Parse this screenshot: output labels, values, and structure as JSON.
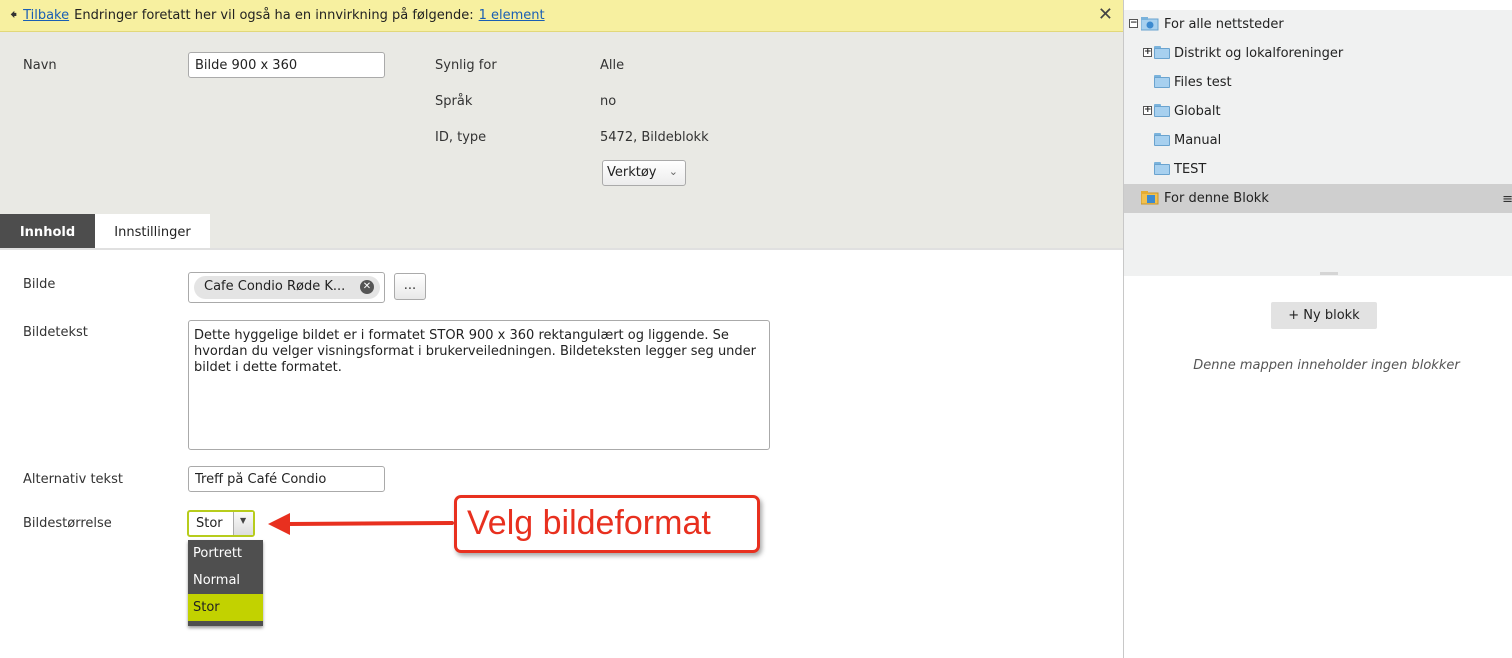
{
  "notice": {
    "back_label": "Tilbake",
    "message": "Endringer foretatt her vil også ha en innvirkning på følgende:",
    "link": "1 element",
    "close": "✕"
  },
  "header": {
    "name_label": "Navn",
    "name_value": "Bilde 900 x 360",
    "visible_label": "Synlig for",
    "visible_value": "Alle",
    "language_label": "Språk",
    "language_value": "no",
    "id_label": "ID, type",
    "id_value": "5472, Bildeblokk",
    "tools_label": "Verktøy"
  },
  "tabs": [
    {
      "label": "Innhold",
      "active": true
    },
    {
      "label": "Innstillinger",
      "active": false
    }
  ],
  "form": {
    "image_label": "Bilde",
    "image_value": "Cafe Condio Røde K...",
    "browse_label": "...",
    "caption_label": "Bildetekst",
    "caption_value": "Dette hyggelige bildet er i formatet STOR 900 x 360 rektangulært og liggende. Se hvordan du velger visningsformat i brukerveiledningen. Bildeteksten legger seg under bildet i dette formatet.",
    "alt_label": "Alternativ tekst",
    "alt_value": "Treff på Café Condio",
    "size_label": "Bildestørrelse",
    "size_value": "Stor",
    "size_options": [
      "Portrett",
      "Normal",
      "Stor"
    ]
  },
  "callout": {
    "text": "Velg bildeformat",
    "color": "#e8301f"
  },
  "tree": {
    "nodes": [
      {
        "label": "For alle nettsteder",
        "expander": "−",
        "icon": "globe-folder-icon"
      },
      {
        "label": "Distrikt og lokalforeninger",
        "expander": "+",
        "icon": "folder-icon"
      },
      {
        "label": "Files test",
        "expander": "",
        "icon": "folder-icon"
      },
      {
        "label": "Globalt",
        "expander": "+",
        "icon": "folder-icon"
      },
      {
        "label": "Manual",
        "expander": "",
        "icon": "folder-icon"
      },
      {
        "label": "TEST",
        "expander": "",
        "icon": "folder-icon"
      },
      {
        "label": "For denne Blokk",
        "expander": "",
        "icon": "block-folder-icon"
      }
    ],
    "menu_icon": "≡"
  },
  "blocks": {
    "new_label": "+ Ny blokk",
    "empty_message": "Denne mappen inneholder ingen blokker"
  },
  "colors": {
    "notice_bg": "#f7f0a0",
    "header_bg": "#e9e9e4",
    "active_tab": "#4d4d4d",
    "select_accent": "#c2d200",
    "link": "#1a5fb4"
  }
}
